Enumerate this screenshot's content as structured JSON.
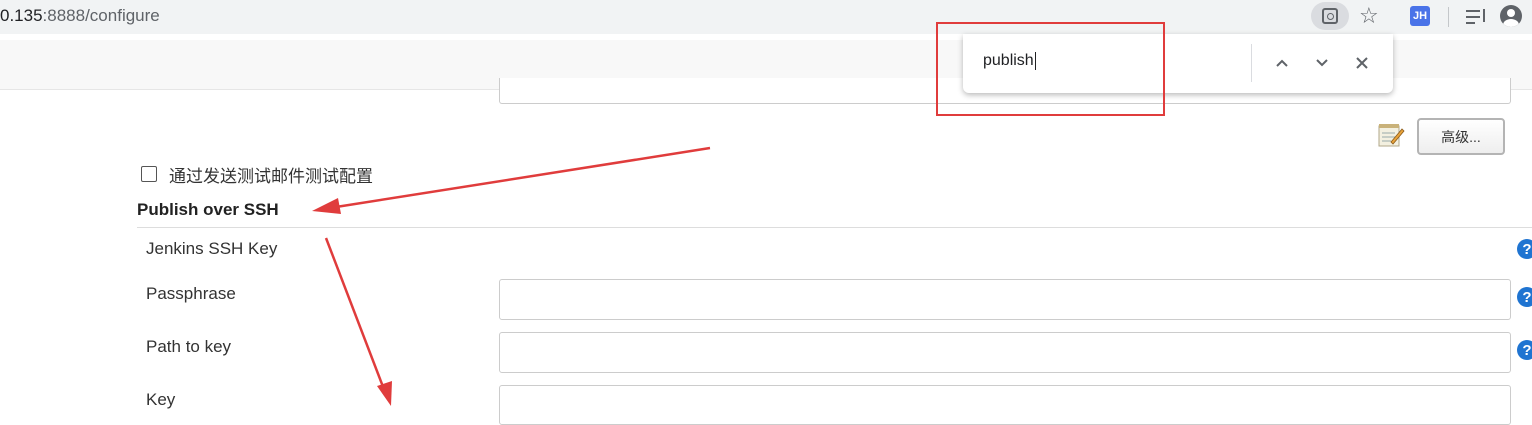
{
  "browser": {
    "url_prefix": "0.135",
    "url_rest": ":8888/configure",
    "extension_label": "JH"
  },
  "find_bar": {
    "query": "publish",
    "prev_icon": "chevron-up-icon",
    "next_icon": "chevron-down-icon",
    "close_icon": "close-icon"
  },
  "page": {
    "advanced_button": "高级...",
    "test_email_checkbox_label": "通过发送测试邮件测试配置",
    "section_title": "Publish over SSH",
    "fields": [
      {
        "label": "Jenkins SSH Key",
        "help": "?"
      },
      {
        "label": "Passphrase",
        "help": "?"
      },
      {
        "label": "Path to key",
        "help": "?"
      },
      {
        "label": "Key"
      }
    ]
  },
  "colors": {
    "annotation_red": "#e03c3c",
    "help_blue": "#1f74d1"
  }
}
